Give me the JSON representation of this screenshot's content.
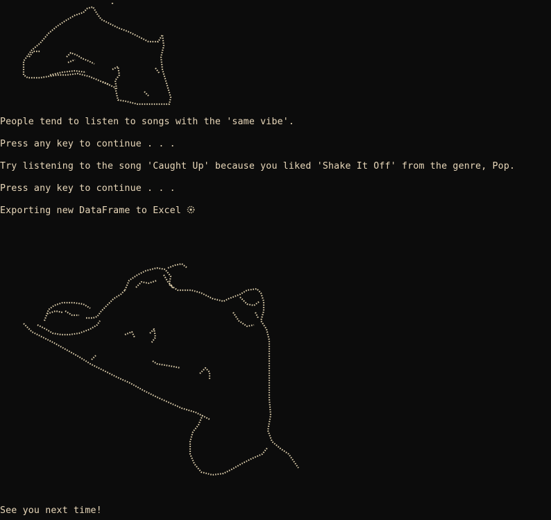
{
  "terminal": {
    "line1": "People tend to listen to songs with the 'same vibe'.",
    "line2": "Press any key to continue . . .",
    "line3": "Try listening to the song 'Caught Up' because you liked 'Shake It Off' from the genre, Pop.",
    "line4": "Press any key to continue . . .",
    "line5": "Exporting new DataFrame to Excel",
    "line6": "See you next time!"
  },
  "colors": {
    "background": "#0c0c0c",
    "text": "#e8d7b9"
  },
  "icons": {
    "spinner": "loading-spinner-icon"
  }
}
